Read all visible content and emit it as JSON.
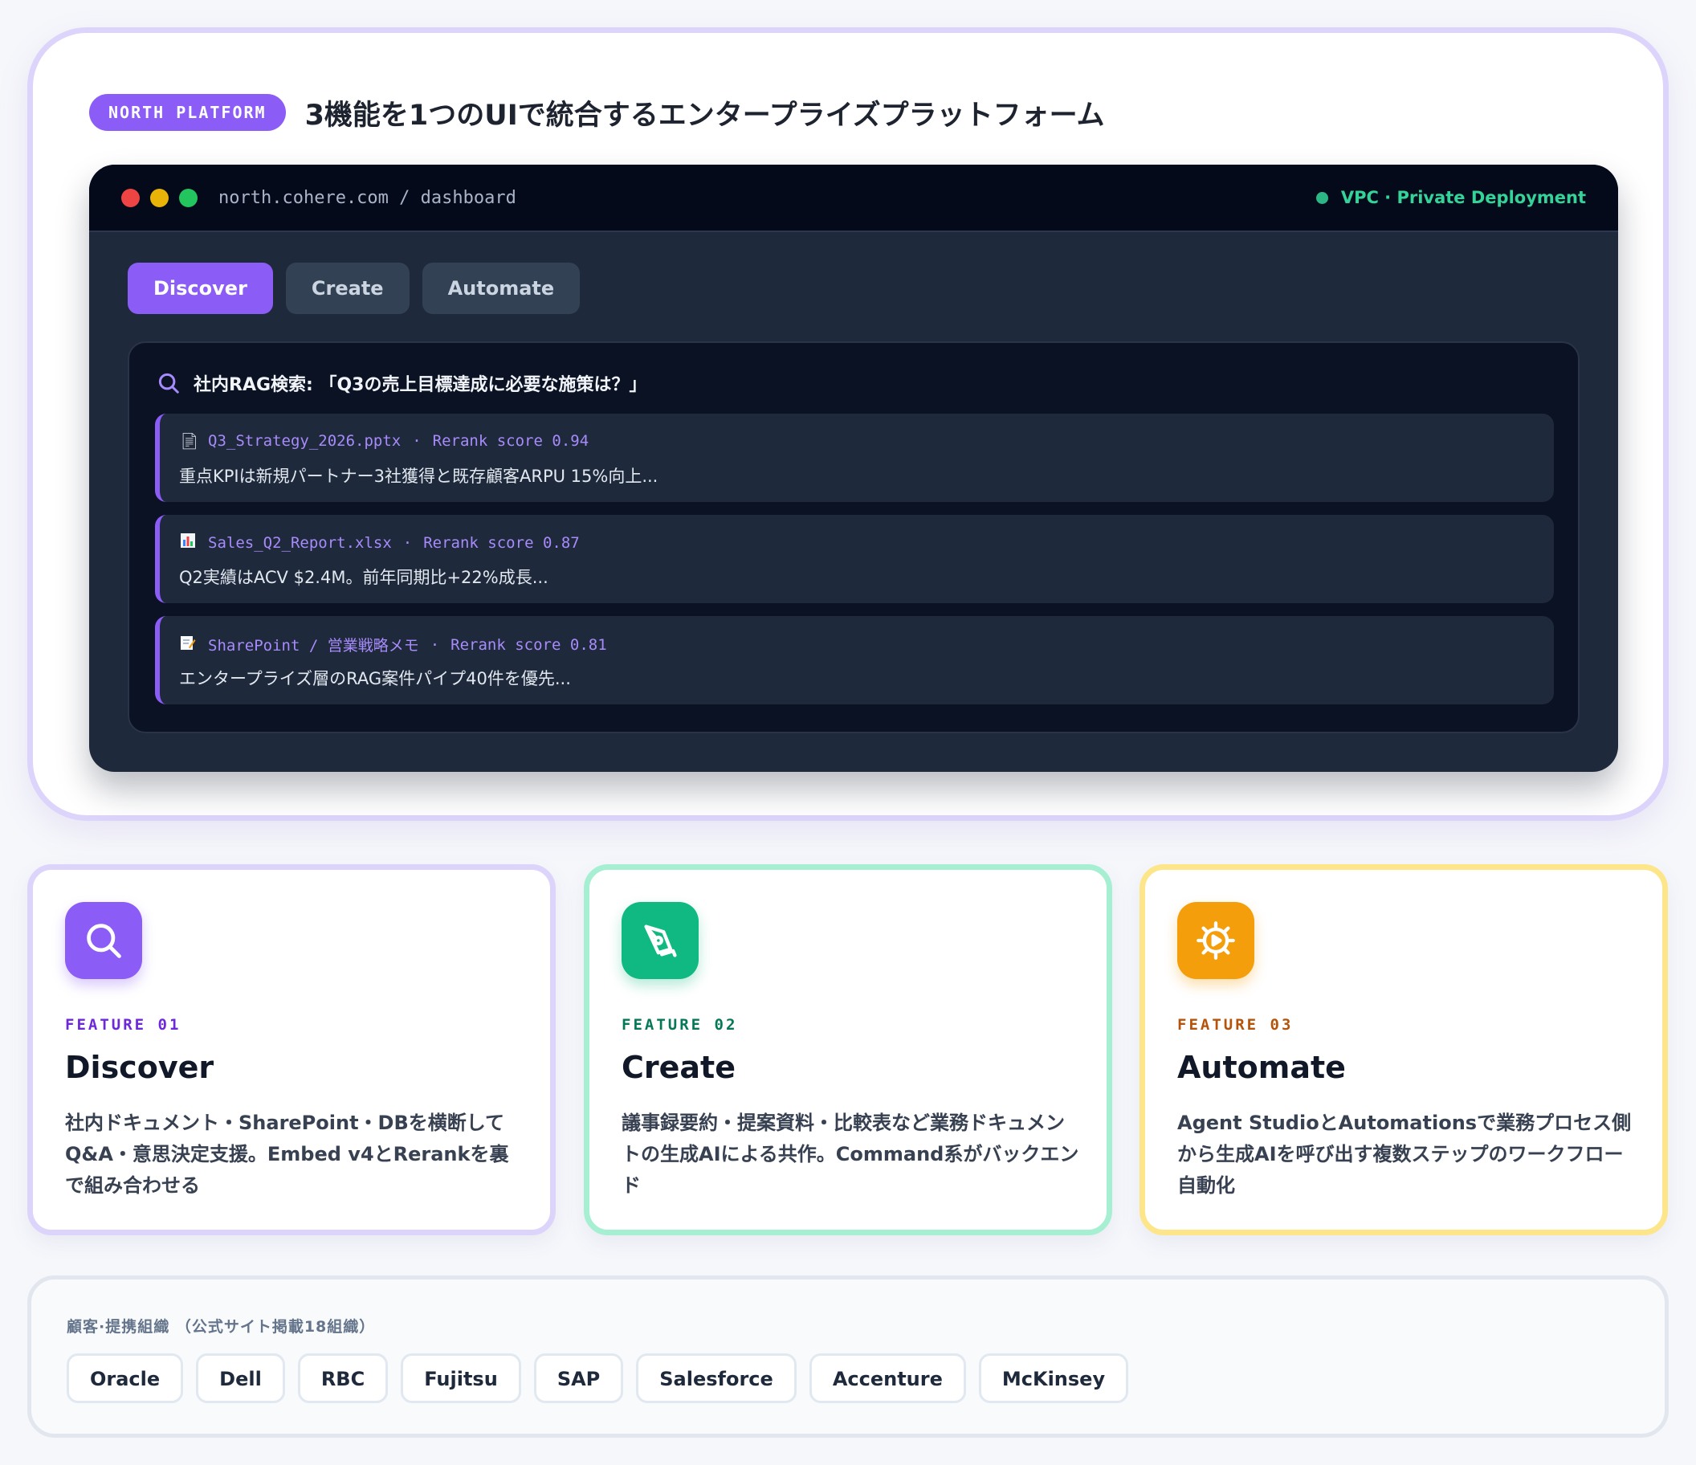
{
  "hero": {
    "badge": "NORTH PLATFORM",
    "title": "3機能を1つのUIで統合するエンタープライズプラットフォーム"
  },
  "window": {
    "url": "north.cohere.com / dashboard",
    "deployment": "VPC · Private Deployment",
    "tabs": [
      {
        "label": "Discover",
        "active": true
      },
      {
        "label": "Create",
        "active": false
      },
      {
        "label": "Automate",
        "active": false
      }
    ],
    "query": "社内RAG検索: 「Q3の売上目標達成に必要な施策は？」",
    "results": [
      {
        "icon": "document-icon",
        "source": "Q3_Strategy_2026.pptx",
        "separator": "·",
        "score": "Rerank score 0.94",
        "snippet": "重点KPIは新規パートナー3社獲得と既存顧客ARPU 15%向上..."
      },
      {
        "icon": "chart-icon",
        "source": "Sales_Q2_Report.xlsx",
        "separator": "·",
        "score": "Rerank score 0.87",
        "snippet": "Q2実績はACV $2.4M。前年同期比+22%成長..."
      },
      {
        "icon": "memo-icon",
        "source": "SharePoint / 営業戦略メモ",
        "separator": "·",
        "score": "Rerank score 0.81",
        "snippet": "エンタープライズ層のRAG案件パイプ40件を優先..."
      }
    ]
  },
  "features": [
    {
      "icon": "search-icon",
      "number": "FEATURE 01",
      "name": "Discover",
      "description": "社内ドキュメント・SharePoint・DBを横断してQ&A・意思決定支援。Embed v4とRerankを裏で組み合わせる"
    },
    {
      "icon": "pen-icon",
      "number": "FEATURE 02",
      "name": "Create",
      "description": "議事録要約・提案資料・比較表など業務ドキュメントの生成AIによる共作。Command系がバックエンド"
    },
    {
      "icon": "gear-icon",
      "number": "FEATURE 03",
      "name": "Automate",
      "description": "Agent StudioとAutomationsで業務プロセス側から生成AIを呼び出す複数ステップのワークフロー自動化"
    }
  ],
  "customers": {
    "label": "顧客·提携組織 （公式サイト掲載18組織）",
    "logos": [
      "Oracle",
      "Dell",
      "RBC",
      "Fujitsu",
      "SAP",
      "Salesforce",
      "Accenture",
      "McKinsey"
    ]
  },
  "colors": {
    "accent": "#8b5cf6",
    "create": "#10b981",
    "automate": "#f59e0b",
    "deploy_status": "#34d399"
  }
}
